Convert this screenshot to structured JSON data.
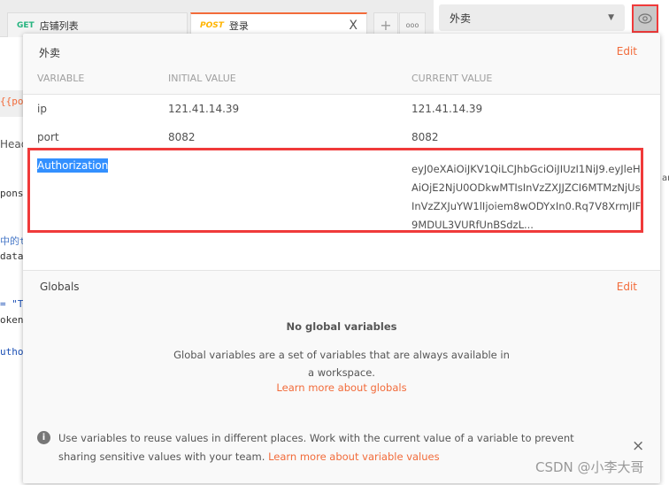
{
  "tabs": [
    {
      "method": "GET",
      "name": "店铺列表",
      "method_color": "#26b47f"
    },
    {
      "method": "POST",
      "name": "登录",
      "method_color": "#ffb400",
      "active": true
    }
  ],
  "tab_actions": {
    "new": "+",
    "more": "ooo",
    "close": "X"
  },
  "environment": {
    "selected": "外卖"
  },
  "background_fragments": [
    "{{por",
    "Head",
    "ponse",
    "中的t",
    "data.",
    "= \"To",
    "oken",
    "uthor",
    "ar"
  ],
  "popup": {
    "env_name": "外卖",
    "edit": "Edit",
    "columns": [
      "VARIABLE",
      "INITIAL VALUE",
      "CURRENT VALUE"
    ],
    "variables": [
      {
        "name": "ip",
        "initial": "121.41.14.39",
        "current": "121.41.14.39"
      },
      {
        "name": "port",
        "initial": "8082",
        "current": "8082"
      },
      {
        "name": "Authorization",
        "initial": "",
        "current": "eyJ0eXAiOiJKV1QiLCJhbGciOiJIUzI1NiJ9.eyJleHAiOjE2NjU0ODkwMTIsInVzZXJJZCI6MTMzNjUsInVzZXJuYW1lIjoiem8wODYxIn0.Rq7V8XrmJIF9MDUL3VURfUnBSdzL..."
      }
    ],
    "globals": {
      "title": "Globals",
      "edit": "Edit",
      "empty_title": "No global variables",
      "empty_desc": "Global variables are a set of variables that are always available in a workspace.",
      "learn_link": "Learn more about globals"
    },
    "info": {
      "text": "Use variables to reuse values in different places. Work with the current value of a variable to prevent sharing sensitive values with your team.",
      "link": "Learn more about variable values",
      "close": "×"
    }
  },
  "watermark": "CSDN @小李大哥",
  "colors": {
    "accent": "#f26b3a",
    "highlight_box": "#f03a3a",
    "selection": "#3390ff"
  }
}
